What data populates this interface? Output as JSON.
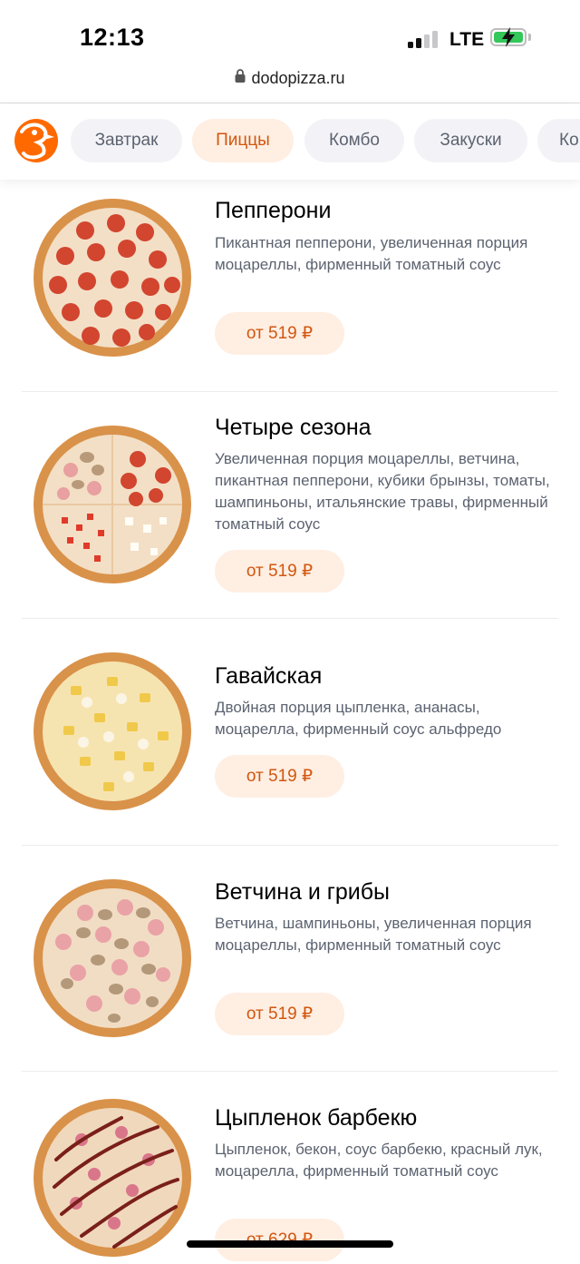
{
  "status_bar": {
    "time": "12:13",
    "network": "LTE",
    "battery_icon": "battery-charging-icon"
  },
  "url_bar": {
    "url": "dodopizza.ru"
  },
  "categories": [
    {
      "label": "Завтрак",
      "active": false
    },
    {
      "label": "Пиццы",
      "active": true
    },
    {
      "label": "Комбо",
      "active": false
    },
    {
      "label": "Закуски",
      "active": false
    },
    {
      "label": "Ко",
      "active": false
    }
  ],
  "colors": {
    "accent": "#d1570f",
    "accent_bg": "#ffeee2",
    "chip_bg": "#f3f3f7",
    "brand": "#ff6900"
  },
  "menu": [
    {
      "title": "Пепперони",
      "description": "Пикантная пепперони, увеличенная порция моцареллы, фирменный томатный соус",
      "price": "от 519 ₽",
      "image_icon": "pizza-pepperoni-image"
    },
    {
      "title": "Четыре сезона",
      "description": "Увеличенная порция моцареллы, ветчина, пикантная пепперони, кубики брынзы, томаты, шампиньоны, итальянские травы, фирменный томатный соус",
      "price": "от 519 ₽",
      "image_icon": "pizza-four-seasons-image"
    },
    {
      "title": "Гавайская",
      "description": "Двойная порция цыпленка, ананасы, моцарелла, фирменный соус альфредо",
      "price": "от 519 ₽",
      "image_icon": "pizza-hawaiian-image"
    },
    {
      "title": "Ветчина и грибы",
      "description": "Ветчина, шампиньоны, увеличенная порция моцареллы, фирменный томатный соус",
      "price": "от 519 ₽",
      "image_icon": "pizza-ham-mushrooms-image"
    },
    {
      "title": "Цыпленок барбекю",
      "description": "Цыпленок, бекон, соус барбекю, красный лук, моцарелла, фирменный томатный соус",
      "price": "от 629 ₽",
      "image_icon": "pizza-bbq-chicken-image"
    }
  ]
}
